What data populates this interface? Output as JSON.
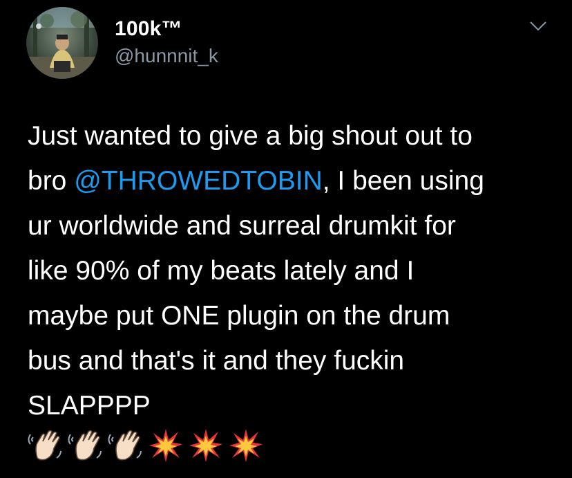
{
  "tweet": {
    "author": {
      "display_name": "100k™",
      "handle": "@hunnnit_k",
      "avatar_icon": "profile-photo"
    },
    "menu_icon": "chevron-down-icon",
    "text": {
      "part1": "Just wanted to give a big shout out to\nbro ",
      "mention": "@THROWEDTOBIN",
      "part2": ", I been using\nur worldwide and surreal drumkit for\nlike 90% of my beats lately and I\nmaybe put ONE plugin on the drum\nbus and that's it and they fuckin\nSLAPPPP"
    },
    "emojis": [
      "waving-hand-icon",
      "waving-hand-icon",
      "waving-hand-icon",
      "collision-icon",
      "collision-icon",
      "collision-icon"
    ]
  },
  "colors": {
    "background": "#000000",
    "text": "#ffffff",
    "secondary_text": "#8b98a5",
    "mention": "#1d9bf0"
  }
}
